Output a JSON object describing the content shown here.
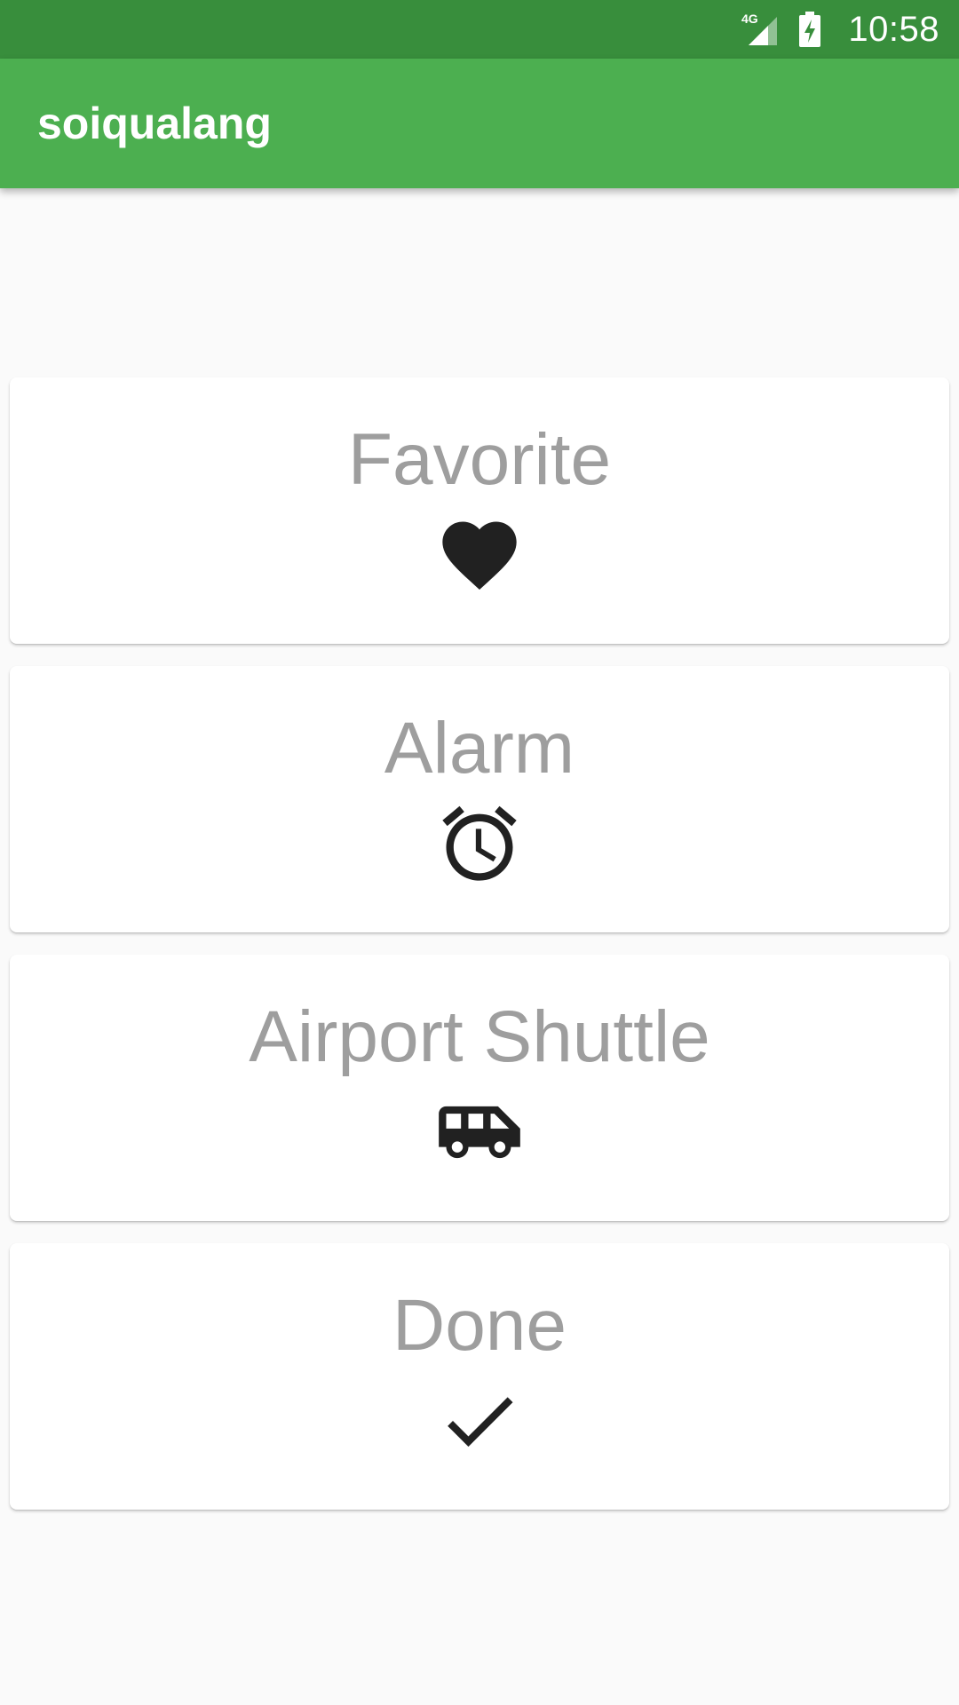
{
  "status_bar": {
    "network": "4G",
    "time": "10:58",
    "icons": [
      "signal-4g-icon",
      "battery-charging-icon"
    ]
  },
  "app_bar": {
    "title": "soiqualang",
    "color": "#4caf50",
    "status_color": "#388e3c"
  },
  "cards": [
    {
      "label": "Favorite",
      "icon": "heart-icon"
    },
    {
      "label": "Alarm",
      "icon": "alarm-clock-icon"
    },
    {
      "label": "Airport Shuttle",
      "icon": "shuttle-van-icon"
    },
    {
      "label": "Done",
      "icon": "checkmark-icon"
    }
  ],
  "colors": {
    "card_text": "#9e9e9e",
    "icon": "#212121",
    "background": "#fafafa"
  }
}
